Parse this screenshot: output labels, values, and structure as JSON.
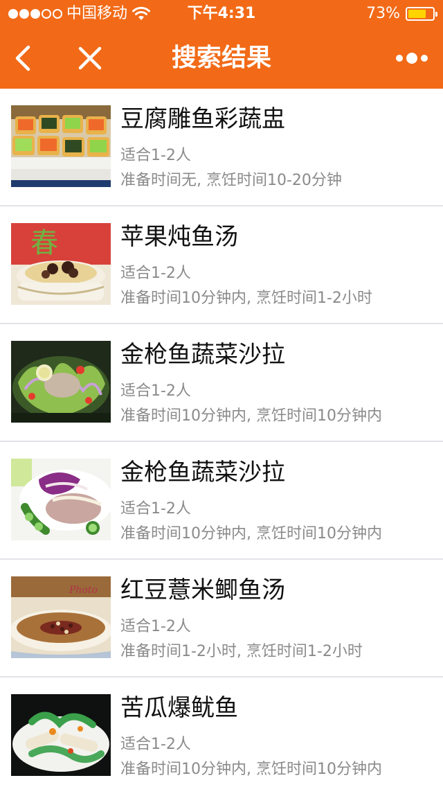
{
  "status_bar": {
    "carrier": "中国移动",
    "time": "下午4:31",
    "battery_percent_label": "73%",
    "battery_level": 0.73,
    "signal_bars_filled": 3,
    "signal_bars_total": 5
  },
  "nav": {
    "title": "搜索结果",
    "back_icon": "chevron-left-icon",
    "close_icon": "close-icon",
    "more_icon": "more-dots-icon"
  },
  "colors": {
    "header": "#F26A17",
    "title_text": "#111111",
    "meta_text": "#8a8a8a",
    "divider": "#E3E3E8",
    "battery": "#FFD400"
  },
  "results": [
    {
      "title": "豆腐雕鱼彩蔬盅",
      "serves": "适合1-2人",
      "time": "准备时间无, 烹饪时间10-20分钟",
      "image": "tofu-cups-photo"
    },
    {
      "title": "苹果炖鱼汤",
      "serves": "适合1-2人",
      "time": "准备时间10分钟内, 烹饪时间1-2小时",
      "image": "apple-fish-soup-photo"
    },
    {
      "title": "金枪鱼蔬菜沙拉",
      "serves": "适合1-2人",
      "time": "准备时间10分钟内, 烹饪时间10分钟内",
      "image": "tuna-salad-photo"
    },
    {
      "title": "金枪鱼蔬菜沙拉",
      "serves": "适合1-2人",
      "time": "准备时间10分钟内, 烹饪时间10分钟内",
      "image": "tuna-salad-plate-photo"
    },
    {
      "title": "红豆薏米鲫鱼汤",
      "serves": "适合1-2人",
      "time": "准备时间1-2小时, 烹饪时间1-2小时",
      "image": "red-bean-fish-soup-photo"
    },
    {
      "title": "苦瓜爆鱿鱼",
      "serves": "适合1-2人",
      "time": "准备时间10分钟内, 烹饪时间10分钟内",
      "image": "bitter-melon-squid-photo"
    }
  ]
}
